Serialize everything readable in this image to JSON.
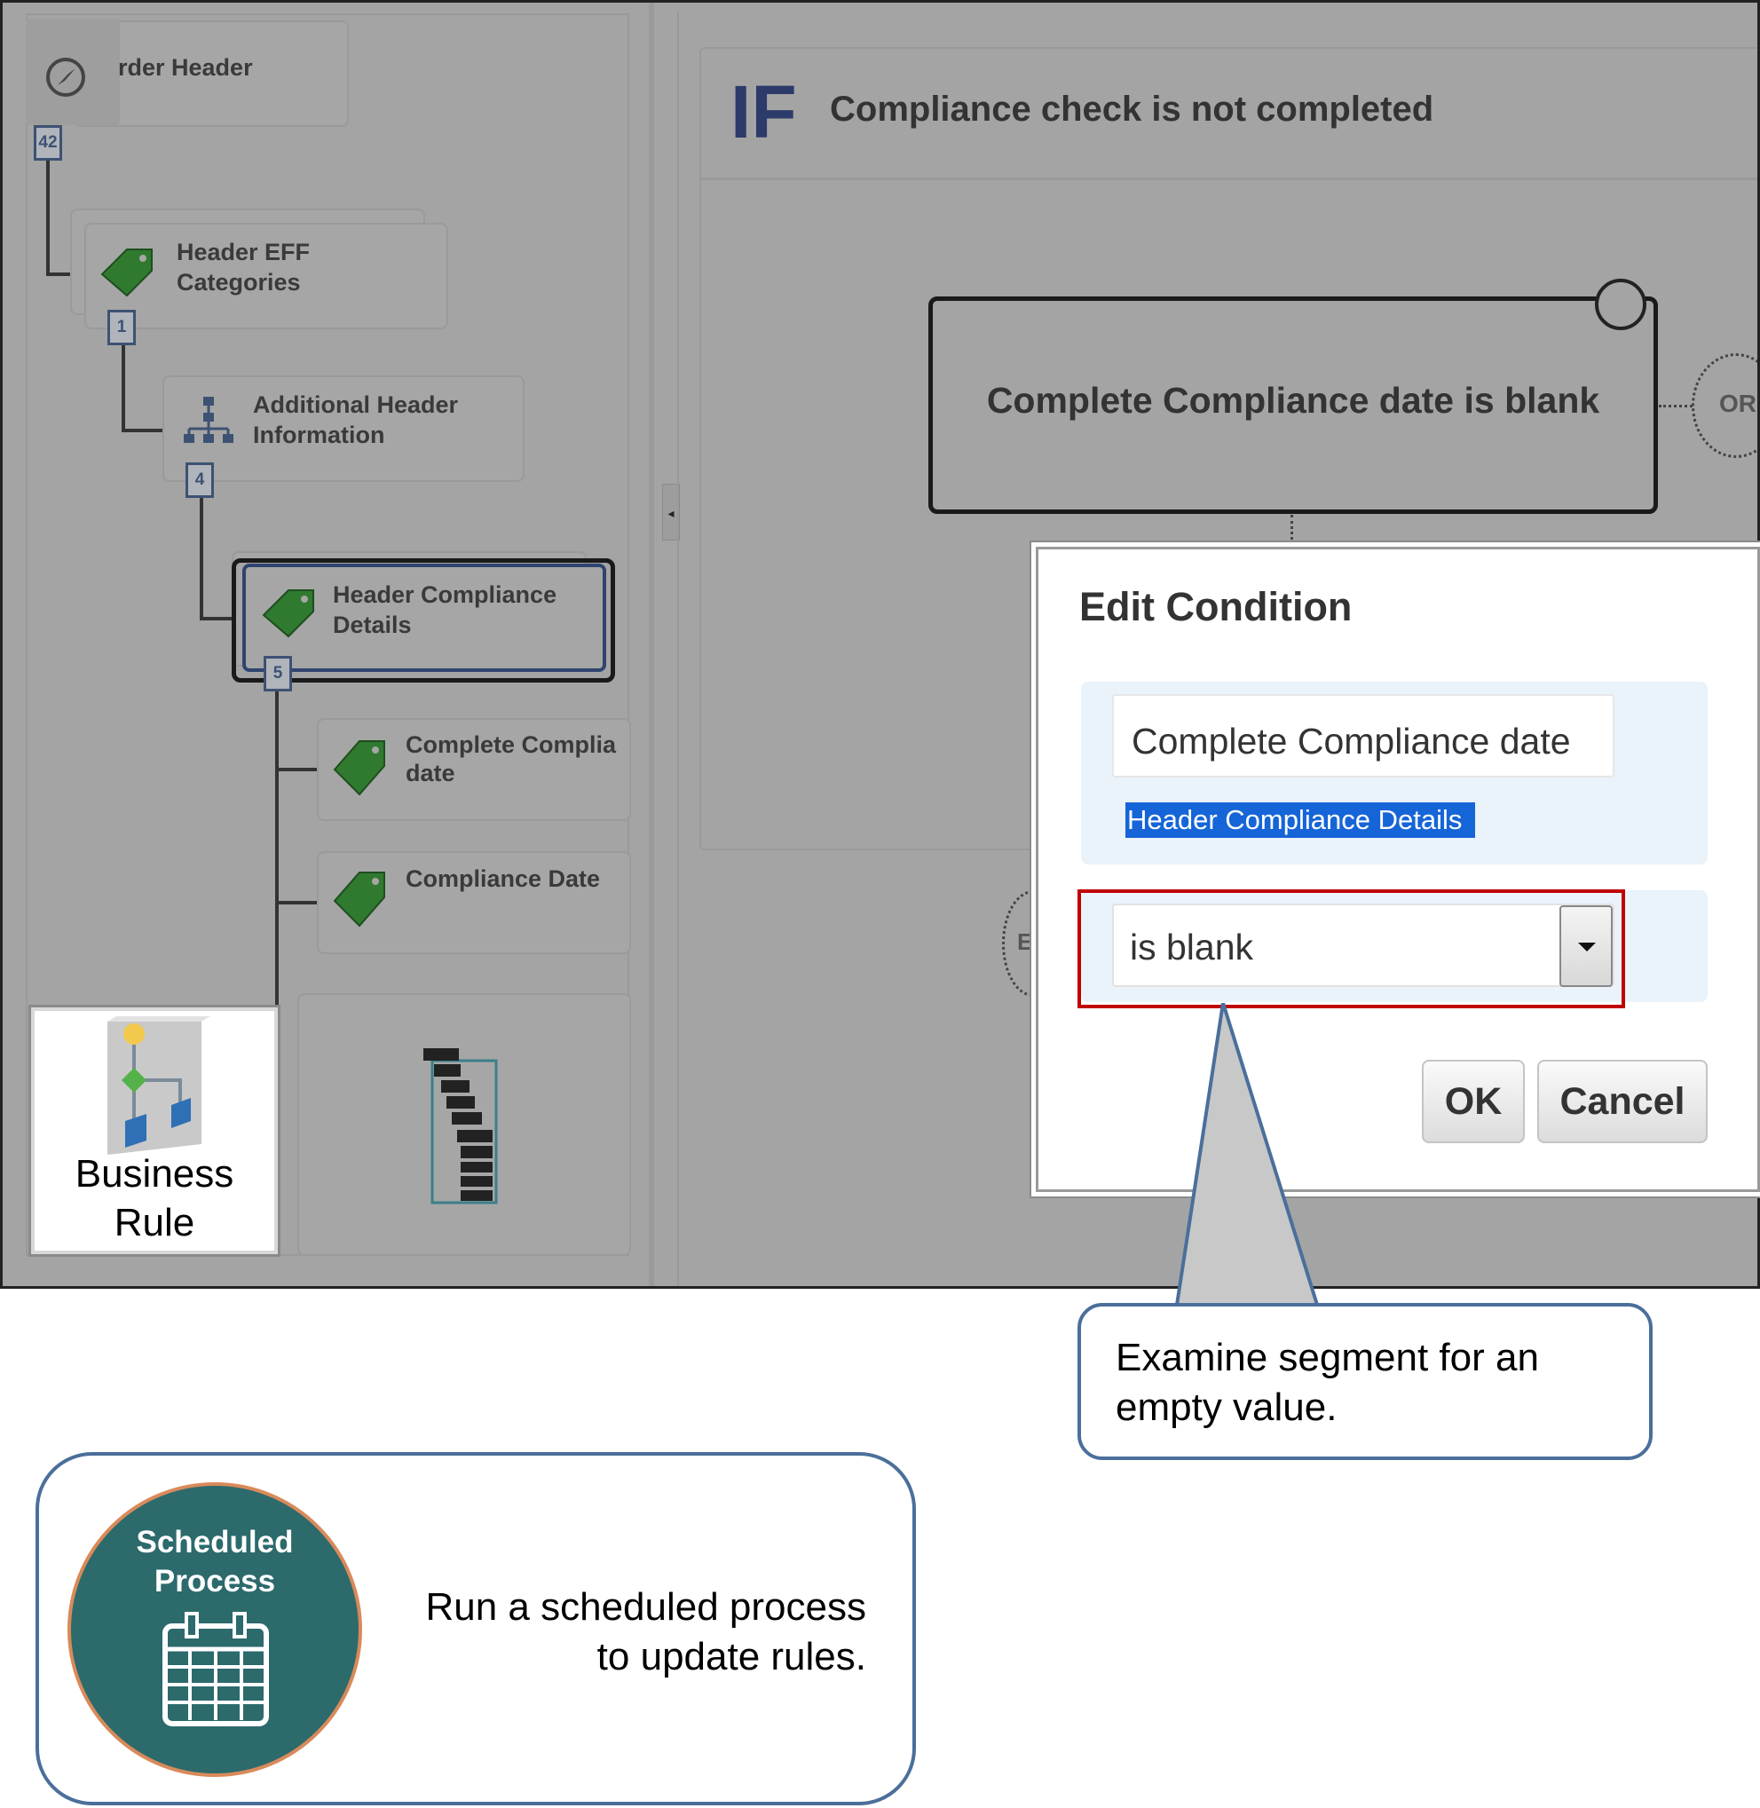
{
  "tree": {
    "root_label": "rder Header",
    "root_count": "42",
    "nodes": [
      {
        "label": "Header EFF\nCategories",
        "count": "1"
      },
      {
        "label": "Additional Header\nInformation",
        "count": "4"
      },
      {
        "label": "Header Compliance\nDetails",
        "count": "5"
      },
      {
        "label": "Complete Complia\ndate"
      },
      {
        "label": "Compliance Date"
      }
    ]
  },
  "rule": {
    "if_keyword": "IF",
    "title": "Compliance check is not completed",
    "condition": "Complete Compliance date is blank",
    "or_label": "OR",
    "else_label": "E"
  },
  "dialog": {
    "title": "Edit Condition",
    "field_value": "Complete Compliance date",
    "field_source": "Header Compliance Details",
    "operator": "is blank",
    "ok_label": "OK",
    "cancel_label": "Cancel"
  },
  "business_rule_card": {
    "label": "Business\nRule"
  },
  "callouts": {
    "examine": "Examine segment for an empty value.",
    "scheduled_title": "Scheduled\nProcess",
    "scheduled_text": "Run a scheduled process\nto update rules."
  },
  "colors": {
    "accent": "#2c3b6a",
    "highlight": "#c00000",
    "callout_border": "#4a6f9a",
    "scheduled": "#2c6a6c"
  }
}
